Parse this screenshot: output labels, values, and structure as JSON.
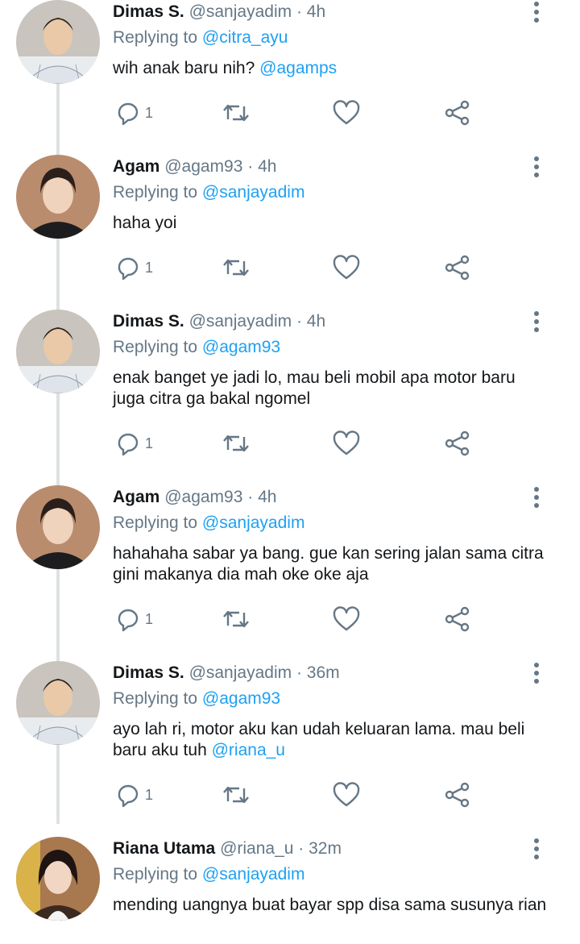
{
  "colors": {
    "accent": "#1da1f2",
    "muted": "#657786",
    "text": "#14171a",
    "thread": "#dde1e4"
  },
  "icons": [
    "reply-icon",
    "retweet-icon",
    "like-icon",
    "share-icon",
    "more-icon"
  ],
  "tweets": [
    {
      "name": "Dimas S.",
      "handle": "@sanjayadim",
      "dot": "·",
      "time": "4h",
      "replying_prefix": "Replying to",
      "replying_to": "@citra_ayu",
      "text": "wih anak baru nih?",
      "text_mention": "@agamps",
      "reply_count": "1"
    },
    {
      "name": "Agam",
      "handle": "@agam93",
      "dot": "·",
      "time": "4h",
      "replying_prefix": "Replying to",
      "replying_to": "@sanjayadim",
      "text": "haha yoi",
      "text_mention": "",
      "reply_count": "1"
    },
    {
      "name": "Dimas S.",
      "handle": "@sanjayadim",
      "dot": "·",
      "time": "4h",
      "replying_prefix": "Replying to",
      "replying_to": "@agam93",
      "text": "enak banget ye jadi lo, mau beli mobil apa motor baru juga citra ga bakal ngomel",
      "text_mention": "",
      "reply_count": "1"
    },
    {
      "name": "Agam",
      "handle": "@agam93",
      "dot": "·",
      "time": "4h",
      "replying_prefix": "Replying to",
      "replying_to": "@sanjayadim",
      "text": "hahahaha sabar ya bang. gue kan sering jalan sama citra gini makanya dia mah oke oke aja",
      "text_mention": "",
      "reply_count": "1"
    },
    {
      "name": "Dimas S.",
      "handle": "@sanjayadim",
      "dot": "·",
      "time": "36m",
      "replying_prefix": "Replying to",
      "replying_to": "@agam93",
      "text": "ayo lah ri, motor aku kan udah keluaran lama. mau beli baru aku tuh",
      "text_mention": "@riana_u",
      "reply_count": "1"
    },
    {
      "name": "Riana Utama",
      "handle": "@riana_u",
      "dot": "·",
      "time": "32m",
      "replying_prefix": "Replying to",
      "replying_to": "@sanjayadim",
      "text": "mending uangnya buat bayar spp disa sama susunya rian",
      "text_mention": "",
      "reply_count": ""
    }
  ]
}
